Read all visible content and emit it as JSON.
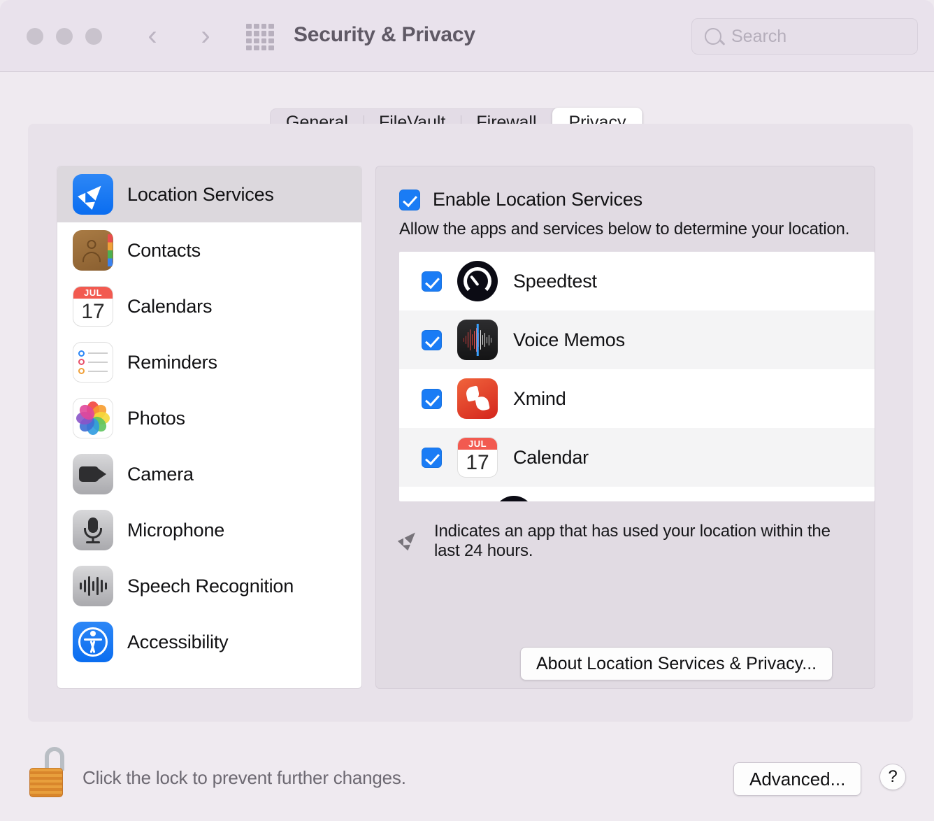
{
  "window": {
    "title": "Security & Privacy",
    "traffic_lights": [
      "close",
      "minimize",
      "zoom"
    ],
    "back_icon": "chevron-left-icon",
    "forward_icon": "chevron-right-icon",
    "grid_icon": "show-all-grid-icon"
  },
  "search": {
    "placeholder": "Search",
    "value": "",
    "icon": "search-icon"
  },
  "tabs": [
    {
      "label": "General",
      "active": false
    },
    {
      "label": "FileVault",
      "active": false
    },
    {
      "label": "Firewall",
      "active": false
    },
    {
      "label": "Privacy",
      "active": true
    }
  ],
  "sidebar": {
    "items": [
      {
        "label": "Location Services",
        "icon": "location-services-icon",
        "selected": true
      },
      {
        "label": "Contacts",
        "icon": "contacts-icon",
        "selected": false
      },
      {
        "label": "Calendars",
        "icon": "calendar-icon",
        "selected": false
      },
      {
        "label": "Reminders",
        "icon": "reminders-icon",
        "selected": false
      },
      {
        "label": "Photos",
        "icon": "photos-icon",
        "selected": false
      },
      {
        "label": "Camera",
        "icon": "camera-icon",
        "selected": false
      },
      {
        "label": "Microphone",
        "icon": "microphone-icon",
        "selected": false
      },
      {
        "label": "Speech Recognition",
        "icon": "speech-recognition-icon",
        "selected": false
      },
      {
        "label": "Accessibility",
        "icon": "accessibility-icon",
        "selected": false
      }
    ]
  },
  "detail": {
    "enable_label": "Enable Location Services",
    "enable_checked": true,
    "description": "Allow the apps and services below to determine your location.",
    "apps": [
      {
        "name": "Speedtest",
        "checked": true,
        "icon": "speedtest-icon"
      },
      {
        "name": "Voice Memos",
        "checked": true,
        "icon": "voice-memos-icon"
      },
      {
        "name": "Xmind",
        "checked": true,
        "icon": "xmind-icon"
      },
      {
        "name": "Calendar",
        "checked": true,
        "icon": "calendar-icon"
      }
    ],
    "note": "Indicates an app that has used your location within the last 24 hours.",
    "note_icon": "location-arrow-icon",
    "about_button": "About Location Services & Privacy..."
  },
  "calendar_icon": {
    "month": "JUL",
    "day": "17"
  },
  "footer": {
    "lock_icon": "unlocked-padlock-icon",
    "lock_text": "Click the lock to prevent further changes.",
    "advanced_button": "Advanced...",
    "help_button": "?"
  },
  "colors": {
    "accent_blue": "#1a7cf5",
    "window_bg": "#efeaf0",
    "titlebar_bg": "#e9e2ec",
    "panel_bg": "#e1dbe3",
    "sidebar_bg": "#ffffff",
    "selected_row": "#dcd8dd"
  }
}
